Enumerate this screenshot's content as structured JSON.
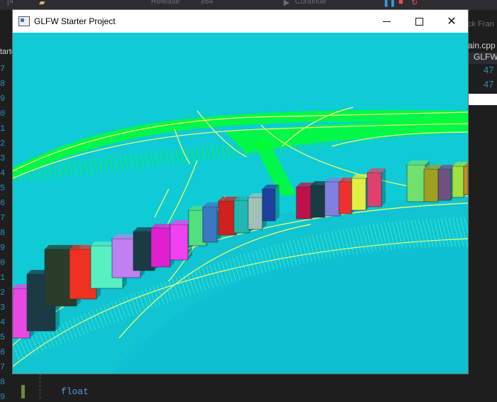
{
  "ide": {
    "tab_prefix": "[4",
    "config": "Release",
    "platform": "x64",
    "continue_label": "Continue",
    "right_text": "ck Fran",
    "tab_file": "ain.cpp",
    "tab_project": "GLFWS",
    "left_fragment": "tarte",
    "line_numbers": [
      "7",
      "8",
      "9",
      "0",
      "1",
      "2",
      "3",
      "4",
      "5",
      "6",
      "7",
      "8",
      "9",
      "0",
      "1",
      "2",
      "3",
      "4",
      "5",
      "6",
      "7",
      "8",
      "9"
    ],
    "right_numbers": [
      "47",
      "47"
    ],
    "code_fragment": "float"
  },
  "window": {
    "title": "GLFW Starter Project",
    "minimize_icon": "minimize-icon",
    "maximize_icon": "maximize-icon",
    "close_icon": "close-icon",
    "background": "#0ecbd6"
  },
  "scene": {
    "road_color": "#ffff66",
    "grass_color": "#00ff33",
    "ground_color": "#10b7cc",
    "building_colors": [
      "#e948e6",
      "#1a3a44",
      "#2a3c2a",
      "#f03020",
      "#58f0c0",
      "#c080f0",
      "#1a3a44",
      "#e020d0",
      "#f040f0",
      "#50e080",
      "#3a78c4",
      "#d02020",
      "#20b8b0",
      "#a0c0b8",
      "#2040a0",
      "#c0104a",
      "#1a3a44",
      "#8080e0",
      "#f03030",
      "#e0f040",
      "#e04070",
      "#70e070",
      "#a0a020",
      "#705080",
      "#a0e040",
      "#c09020"
    ]
  }
}
